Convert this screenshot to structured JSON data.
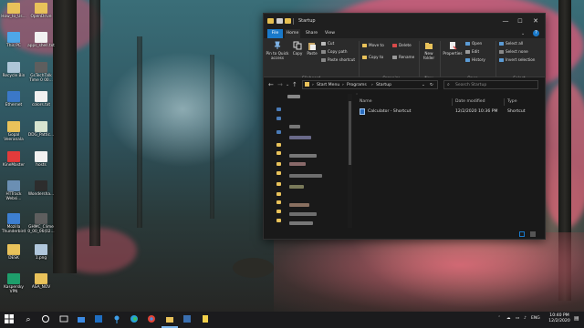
{
  "desktop": {
    "icons": [
      {
        "label": "How_to_Us..."
      },
      {
        "label": "OpenDrive"
      },
      {
        "label": "This PC"
      },
      {
        "label": "apps_shell.txt"
      },
      {
        "label": "Recycle Bin"
      },
      {
        "label": "GsTechTalk Time 0 00..."
      },
      {
        "label": "Ethernet"
      },
      {
        "label": "colors.txt"
      },
      {
        "label": "Gopal Veeranala"
      },
      {
        "label": "DDG_Pattic..."
      },
      {
        "label": "KineMaster"
      },
      {
        "label": "hosts"
      },
      {
        "label": "HTTrack Websi..."
      },
      {
        "label": "Wondersha..."
      },
      {
        "label": "Mozilla Thunderbird"
      },
      {
        "label": "GHMC_Clime 0_00_06(02..."
      },
      {
        "label": "DESK"
      },
      {
        "label": "1.png"
      },
      {
        "label": "Kaspersky VPN"
      },
      {
        "label": "ASA_NOV"
      }
    ]
  },
  "window": {
    "title": "Startup",
    "controls": {
      "minimize": "—",
      "maximize": "☐",
      "close": "✕"
    },
    "tabs": [
      "File",
      "Home",
      "Share",
      "View"
    ],
    "ribbon": {
      "pin_quick_access": "Pin to Quick access",
      "copy": "Copy",
      "paste": "Paste",
      "cut": "Cut",
      "copy_path": "Copy path",
      "paste_shortcut": "Paste shortcut",
      "move_to": "Move to",
      "copy_to": "Copy to",
      "delete": "Delete",
      "rename": "Rename",
      "new_folder": "New folder",
      "properties": "Properties",
      "open": "Open",
      "edit": "Edit",
      "history": "History",
      "select_all": "Select all",
      "select_none": "Select none",
      "invert_selection": "Invert selection",
      "groups": {
        "clipboard": "Clipboard",
        "organize": "Organize",
        "new": "New",
        "open": "Open",
        "select": "Select"
      }
    },
    "address": {
      "crumbs": [
        "Start Menu",
        "Programs",
        "Startup"
      ],
      "search_placeholder": "Search Startup"
    },
    "columns": {
      "name": "Name",
      "date": "Date modified",
      "type": "Type"
    },
    "files": [
      {
        "name": "Calculator - Shortcut",
        "date": "12/2/2020 10:36 PM",
        "type": "Shortcut"
      }
    ]
  },
  "taskbar": {
    "lang": "ENG",
    "time": "10:40 PM",
    "date": "12/2/2020"
  },
  "colors": {
    "accent": "#1979ca",
    "window_bg": "#191919",
    "ribbon_bg": "#2b2b2b"
  }
}
